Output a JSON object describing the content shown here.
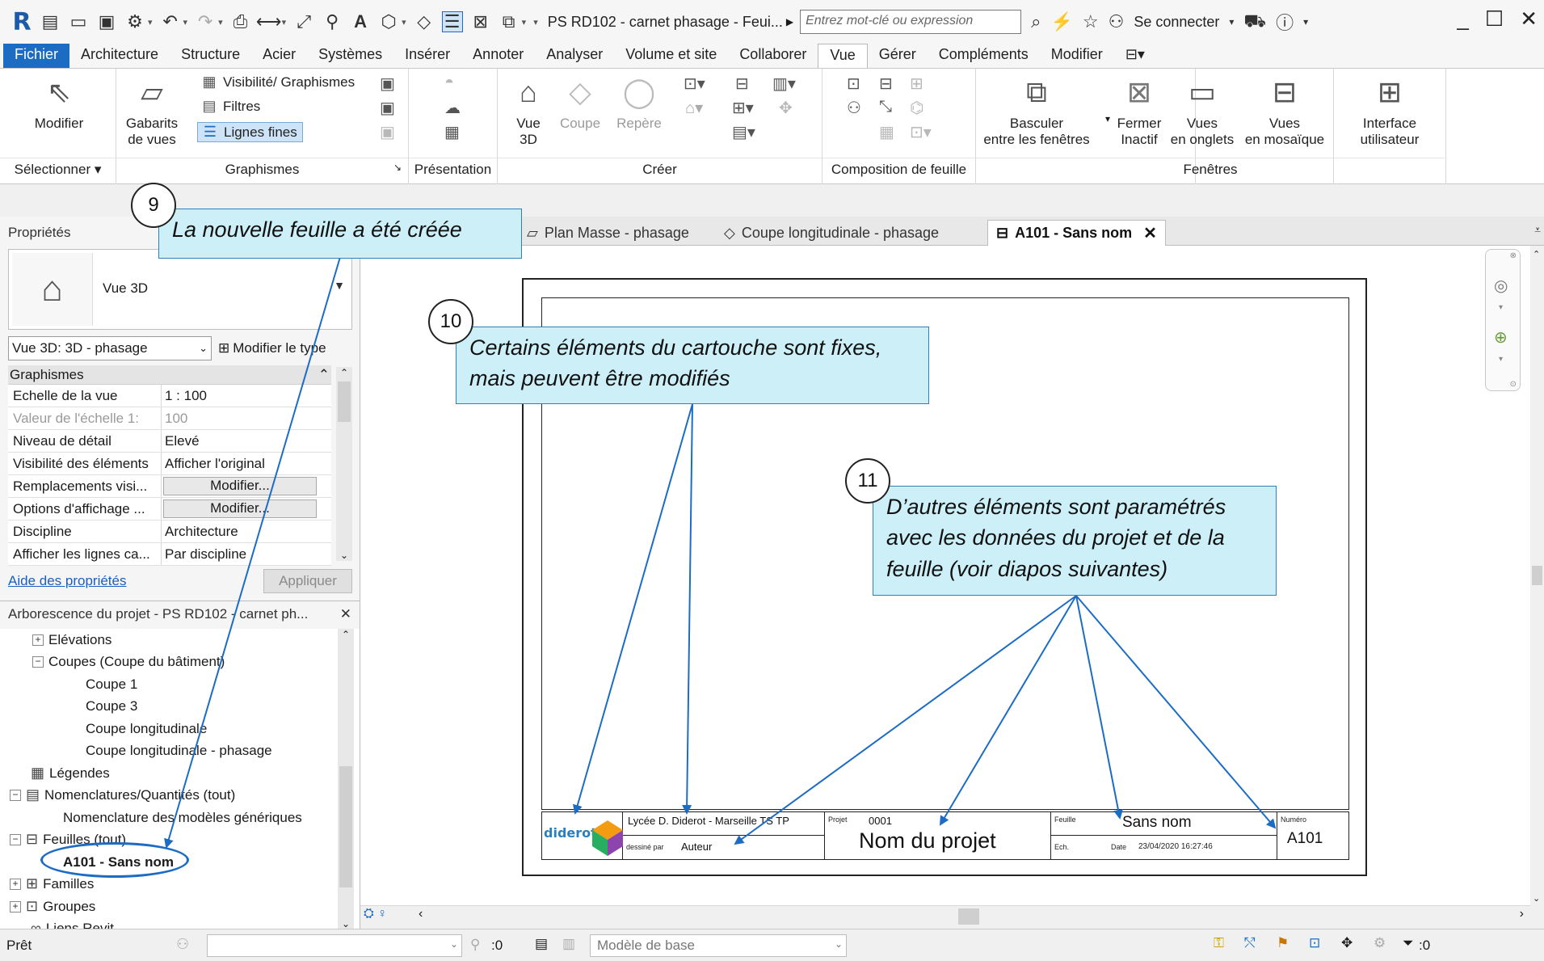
{
  "title_bar": {
    "doc_title": "PS RD102 - carnet phasage - Feui...",
    "search_placeholder": "Entrez mot-clé ou expression",
    "login": "Se connecter",
    "app_icon": "R"
  },
  "menu_tabs": [
    "Fichier",
    "Architecture",
    "Structure",
    "Acier",
    "Systèmes",
    "Insérer",
    "Annoter",
    "Analyser",
    "Volume et site",
    "Collaborer",
    "Vue",
    "Gérer",
    "Compléments",
    "Modifier"
  ],
  "active_menu_tab": "Vue",
  "ribbon": {
    "select": {
      "modify": "Modifier",
      "title": "Sélectionner"
    },
    "graphics": {
      "templates": "Gabarits\nde vues",
      "visibility": "Visibilité/ Graphismes",
      "filters": "Filtres",
      "thin_lines": "Lignes fines",
      "title": "Graphismes"
    },
    "presentation": {
      "title": "Présentation"
    },
    "create": {
      "view3d": "Vue\n3D",
      "section": "Coupe",
      "callout": "Repère",
      "title": "Créer"
    },
    "sheet_composition": {
      "title": "Composition de feuille"
    },
    "windows": {
      "switch": "Basculer\nentre les fenêtres",
      "close_inactive": "Fermer\nInactif",
      "tab_views": "Vues\nen onglets",
      "tile_views": "Vues\nen mosaïque",
      "title": "Fenêtres"
    },
    "user_interface": {
      "label": "Interface\nutilisateur"
    }
  },
  "properties": {
    "header": "Propriétés",
    "type_name": "Vue 3D",
    "instance_selector": "Vue 3D: 3D - phasage",
    "edit_type": "Modifier le type",
    "group": "Graphismes",
    "rows": [
      {
        "k": "Echelle de la vue",
        "v": "1 : 100"
      },
      {
        "k": "Valeur de l'échelle    1:",
        "v": "100"
      },
      {
        "k": "Niveau de détail",
        "v": "Elevé"
      },
      {
        "k": "Visibilité des éléments",
        "v": "Afficher l'original"
      },
      {
        "k": "Remplacements visi...",
        "v": "Modifier..."
      },
      {
        "k": "Options d'affichage ...",
        "v": "Modifier..."
      },
      {
        "k": "Discipline",
        "v": "Architecture"
      },
      {
        "k": "Afficher les lignes ca...",
        "v": "Par discipline"
      }
    ],
    "help": "Aide des propriétés",
    "apply": "Appliquer"
  },
  "browser": {
    "header": "Arborescence du projet - PS RD102 - carnet ph...",
    "nodes": [
      {
        "label": "Elévations"
      },
      {
        "label": "Coupes (Coupe du bâtiment)"
      },
      {
        "label": "Coupe 1"
      },
      {
        "label": "Coupe 3"
      },
      {
        "label": "Coupe longitudinale"
      },
      {
        "label": "Coupe longitudinale - phasage"
      },
      {
        "label": "Légendes"
      },
      {
        "label": "Nomenclatures/Quantités (tout)"
      },
      {
        "label": "Nomenclature des modèles génériques"
      },
      {
        "label": "Feuilles (tout)"
      },
      {
        "label": "A101 - Sans nom"
      },
      {
        "label": "Familles"
      },
      {
        "label": "Groupes"
      },
      {
        "label": "Liens Revit"
      }
    ]
  },
  "view_tabs": [
    {
      "label": "Plan Masse - phasage"
    },
    {
      "label": "Coupe longitudinale - phasage"
    },
    {
      "label": "A101 - Sans nom"
    }
  ],
  "title_block": {
    "logo": "diderot",
    "school": "Lycée D. Diderot - Marseille   TS TP",
    "drawn_by_label": "dessiné par",
    "author": "Auteur",
    "project_label": "Projet",
    "project_number": "0001",
    "project_name": "Nom du projet",
    "sheet_label": "Feuille",
    "sheet_name": "Sans nom",
    "number_label": "Numéro",
    "sheet_number": "A101",
    "scale_label": "Ech.",
    "date_label": "Date",
    "date": "23/04/2020 16:27:46"
  },
  "status": {
    "ready": "Prêt",
    "worksets": ":0",
    "model": "Modèle de base",
    "filter": ":0"
  },
  "callouts": [
    {
      "number": "9",
      "text": "La nouvelle feuille a été créée"
    },
    {
      "number": "10",
      "line1": "Certains éléments du cartouche sont fixes,",
      "line2": "mais peuvent être modifiés"
    },
    {
      "number": "11",
      "line1": "D’autres éléments sont paramétrés",
      "line2": "avec les données du projet et de la",
      "line3": "feuille (voir diapos suivantes)"
    }
  ],
  "colors": {
    "accent": "#1d6cc4",
    "callout_bg": "#cdf0f8",
    "arrow": "#1d6cc4"
  }
}
